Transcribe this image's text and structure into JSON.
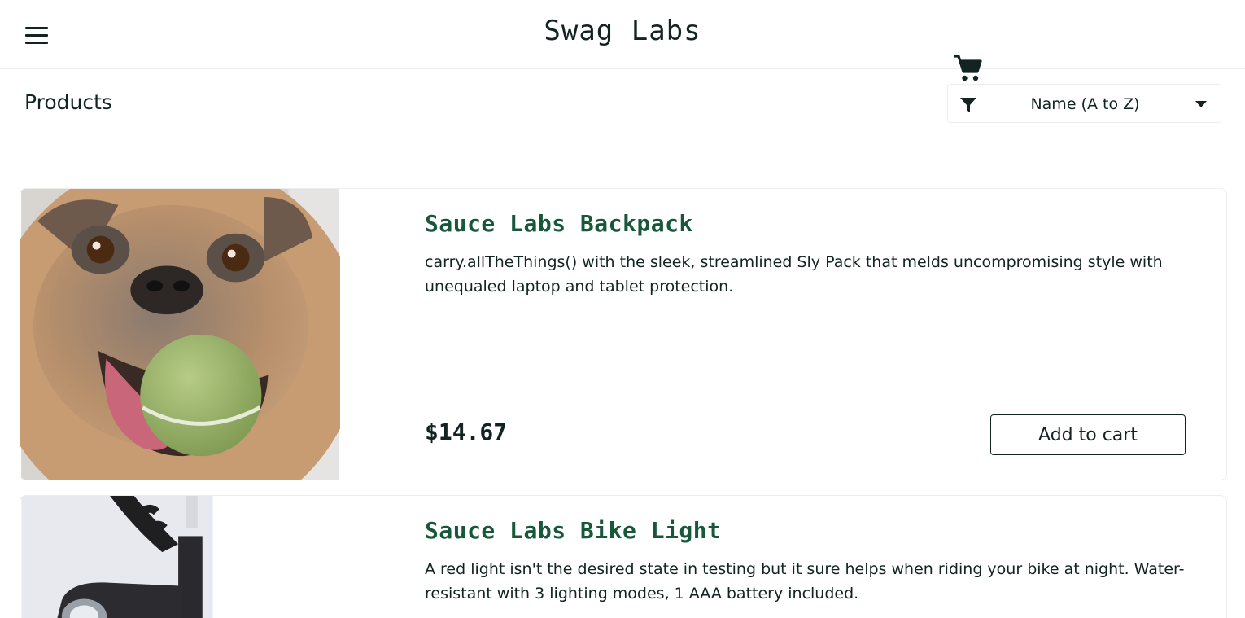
{
  "header": {
    "logo": "Swag Labs",
    "menu_icon": "hamburger-menu-icon",
    "cart_icon": "shopping-cart-icon"
  },
  "secondary": {
    "title": "Products",
    "sort": {
      "icon": "filter-icon",
      "selected": "Name (A to Z)",
      "caret_icon": "caret-down-icon"
    }
  },
  "products": [
    {
      "name": "Sauce Labs Backpack",
      "description": "carry.allTheThings() with the sleek, streamlined Sly Pack that melds uncompromising style with unequaled laptop and tablet protection.",
      "price": "$14.67",
      "button": "Add to cart",
      "image": "pug-with-tennis-ball-photo"
    },
    {
      "name": "Sauce Labs Bike Light",
      "description": "A red light isn't the desired state in testing but it sure helps when riding your bike at night. Water-resistant with 3 lighting modes, 1 AAA battery included.",
      "image": "bike-light-photo"
    }
  ],
  "colors": {
    "text": "#132322",
    "product_name": "#18583a",
    "border": "#ededed"
  }
}
